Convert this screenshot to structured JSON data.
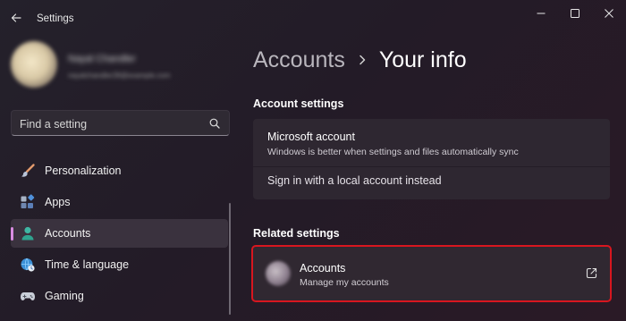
{
  "window": {
    "title": "Settings",
    "controls": [
      "minimize-icon",
      "maximize-icon",
      "close-icon"
    ]
  },
  "user": {
    "name": "Nayal Chandler",
    "email": "nayalchandler28@example.com"
  },
  "search": {
    "placeholder": "Find a setting",
    "value": ""
  },
  "sidebar": {
    "items": [
      {
        "label": "Personalization",
        "icon": "paintbrush-icon",
        "active": false
      },
      {
        "label": "Apps",
        "icon": "apps-icon",
        "active": false
      },
      {
        "label": "Accounts",
        "icon": "person-icon",
        "active": true
      },
      {
        "label": "Time & language",
        "icon": "globe-clock-icon",
        "active": false
      },
      {
        "label": "Gaming",
        "icon": "gamepad-icon",
        "active": false
      }
    ]
  },
  "breadcrumb": {
    "parent": "Accounts",
    "current": "Your info"
  },
  "account_settings": {
    "heading": "Account settings",
    "microsoft_account": {
      "title": "Microsoft account",
      "description": "Windows is better when settings and files automatically sync"
    },
    "local_account_link": "Sign in with a local account instead"
  },
  "related_settings": {
    "heading": "Related settings",
    "accounts": {
      "title": "Accounts",
      "description": "Manage my accounts",
      "icon": "open-external-icon"
    }
  },
  "colors": {
    "accent": "#d88be0",
    "highlight_border": "#d8161f",
    "background": "#231b27",
    "card": "#2e2731"
  }
}
